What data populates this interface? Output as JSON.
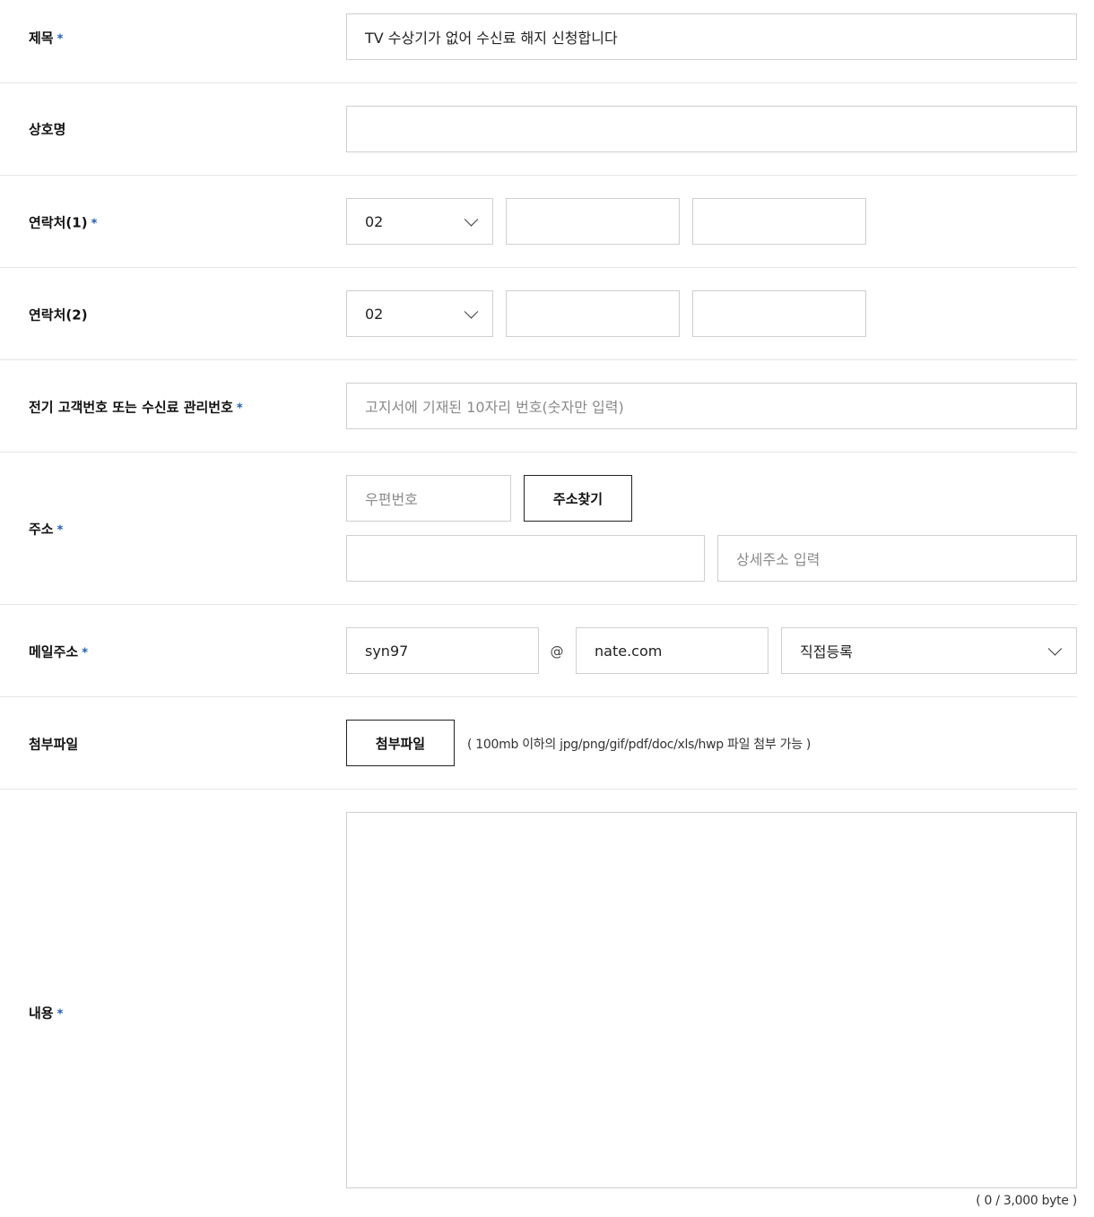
{
  "required_mark": "*",
  "fields": {
    "title": {
      "label": "제목",
      "value": "TV 수상기가 없어 수신료 해지 신청합니다"
    },
    "company": {
      "label": "상호명",
      "value": ""
    },
    "phone1": {
      "label": "연락처(1)",
      "area_code": "02",
      "middle": "",
      "last": ""
    },
    "phone2": {
      "label": "연락처(2)",
      "area_code": "02",
      "middle": "",
      "last": ""
    },
    "customer_no": {
      "label": "전기 고객번호 또는 수신료 관리번호",
      "placeholder": "고지서에 기재된 10자리 번호(숫자만 입력)"
    },
    "address": {
      "label": "주소",
      "zip_placeholder": "우편번호",
      "search_button": "주소찾기",
      "base_value": "",
      "detail_placeholder": "상세주소 입력"
    },
    "email": {
      "label": "메일주소",
      "id": "syn97",
      "at": "@",
      "domain": "nate.com",
      "domain_select": "직접등록"
    },
    "attachment": {
      "label": "첨부파일",
      "button": "첨부파일",
      "note": "( 100mb 이하의 jpg/png/gif/pdf/doc/xls/hwp 파일 첨부 가능 )"
    },
    "content": {
      "label": "내용",
      "value": "",
      "counter": "( 0 / 3,000 byte )"
    }
  },
  "colors": {
    "required": "#1e5bb8",
    "border": "#cfcfcf",
    "divider": "#e6e6e6"
  }
}
